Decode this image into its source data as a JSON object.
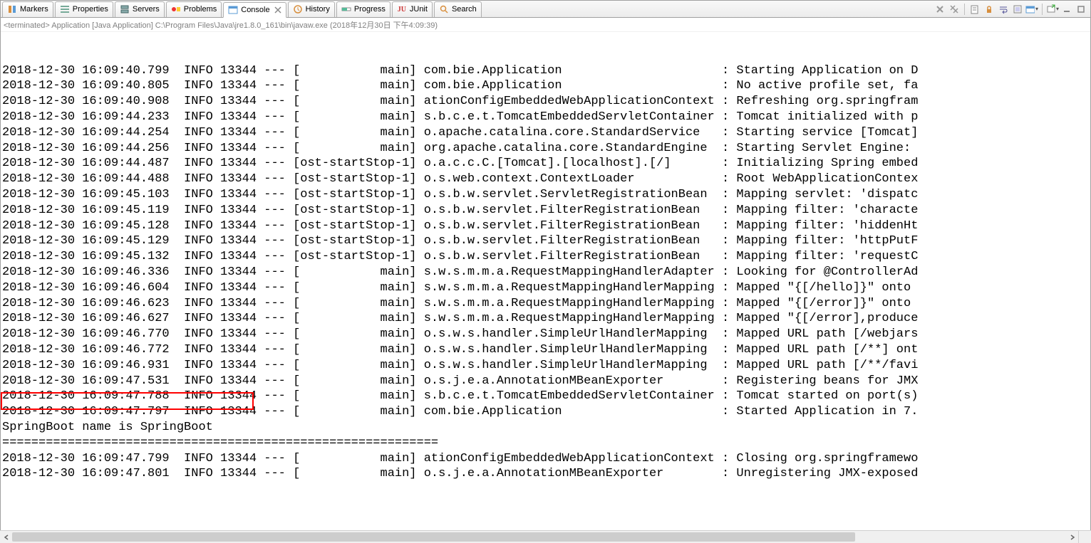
{
  "tabs": [
    {
      "label": "Markers",
      "icon": "markers-icon"
    },
    {
      "label": "Properties",
      "icon": "properties-icon"
    },
    {
      "label": "Servers",
      "icon": "servers-icon"
    },
    {
      "label": "Problems",
      "icon": "problems-icon"
    },
    {
      "label": "Console",
      "icon": "console-icon",
      "active": true
    },
    {
      "label": "History",
      "icon": "history-icon"
    },
    {
      "label": "Progress",
      "icon": "progress-icon"
    },
    {
      "label": "JUnit",
      "icon": "junit-icon"
    },
    {
      "label": "Search",
      "icon": "search-icon"
    }
  ],
  "status": "<terminated> Application [Java Application] C:\\Program Files\\Java\\jre1.8.0_161\\bin\\javaw.exe (2018年12月30日 下午4:09:39)",
  "log_lines": [
    "2018-12-30 16:09:40.799  INFO 13344 --- [           main] com.bie.Application                      : Starting Application on D",
    "2018-12-30 16:09:40.805  INFO 13344 --- [           main] com.bie.Application                      : No active profile set, fa",
    "2018-12-30 16:09:40.908  INFO 13344 --- [           main] ationConfigEmbeddedWebApplicationContext : Refreshing org.springfram",
    "2018-12-30 16:09:44.233  INFO 13344 --- [           main] s.b.c.e.t.TomcatEmbeddedServletContainer : Tomcat initialized with p",
    "2018-12-30 16:09:44.254  INFO 13344 --- [           main] o.apache.catalina.core.StandardService   : Starting service [Tomcat]",
    "2018-12-30 16:09:44.256  INFO 13344 --- [           main] org.apache.catalina.core.StandardEngine  : Starting Servlet Engine: ",
    "2018-12-30 16:09:44.487  INFO 13344 --- [ost-startStop-1] o.a.c.c.C.[Tomcat].[localhost].[/]       : Initializing Spring embed",
    "2018-12-30 16:09:44.488  INFO 13344 --- [ost-startStop-1] o.s.web.context.ContextLoader            : Root WebApplicationContex",
    "2018-12-30 16:09:45.103  INFO 13344 --- [ost-startStop-1] o.s.b.w.servlet.ServletRegistrationBean  : Mapping servlet: 'dispatc",
    "2018-12-30 16:09:45.119  INFO 13344 --- [ost-startStop-1] o.s.b.w.servlet.FilterRegistrationBean   : Mapping filter: 'characte",
    "2018-12-30 16:09:45.128  INFO 13344 --- [ost-startStop-1] o.s.b.w.servlet.FilterRegistrationBean   : Mapping filter: 'hiddenHt",
    "2018-12-30 16:09:45.129  INFO 13344 --- [ost-startStop-1] o.s.b.w.servlet.FilterRegistrationBean   : Mapping filter: 'httpPutF",
    "2018-12-30 16:09:45.132  INFO 13344 --- [ost-startStop-1] o.s.b.w.servlet.FilterRegistrationBean   : Mapping filter: 'requestC",
    "2018-12-30 16:09:46.336  INFO 13344 --- [           main] s.w.s.m.m.a.RequestMappingHandlerAdapter : Looking for @ControllerAd",
    "2018-12-30 16:09:46.604  INFO 13344 --- [           main] s.w.s.m.m.a.RequestMappingHandlerMapping : Mapped \"{[/hello]}\" onto ",
    "2018-12-30 16:09:46.623  INFO 13344 --- [           main] s.w.s.m.m.a.RequestMappingHandlerMapping : Mapped \"{[/error]}\" onto ",
    "2018-12-30 16:09:46.627  INFO 13344 --- [           main] s.w.s.m.m.a.RequestMappingHandlerMapping : Mapped \"{[/error],produce",
    "2018-12-30 16:09:46.770  INFO 13344 --- [           main] o.s.w.s.handler.SimpleUrlHandlerMapping  : Mapped URL path [/webjars",
    "2018-12-30 16:09:46.772  INFO 13344 --- [           main] o.s.w.s.handler.SimpleUrlHandlerMapping  : Mapped URL path [/**] ont",
    "2018-12-30 16:09:46.931  INFO 13344 --- [           main] o.s.w.s.handler.SimpleUrlHandlerMapping  : Mapped URL path [/**/favi",
    "2018-12-30 16:09:47.531  INFO 13344 --- [           main] o.s.j.e.a.AnnotationMBeanExporter        : Registering beans for JMX",
    "2018-12-30 16:09:47.788  INFO 13344 --- [           main] s.b.c.e.t.TomcatEmbeddedServletContainer : Tomcat started on port(s)",
    "2018-12-30 16:09:47.797  INFO 13344 --- [           main] com.bie.Application                      : Started Application in 7."
  ],
  "highlight_line": "SpringBoot name is SpringBoot",
  "separator": "============================================================",
  "closing_lines": [
    "2018-12-30 16:09:47.799  INFO 13344 --- [           main] ationConfigEmbeddedWebApplicationContext : Closing org.springframewo",
    "2018-12-30 16:09:47.801  INFO 13344 --- [           main] o.s.j.e.a.AnnotationMBeanExporter        : Unregistering JMX-exposed"
  ]
}
